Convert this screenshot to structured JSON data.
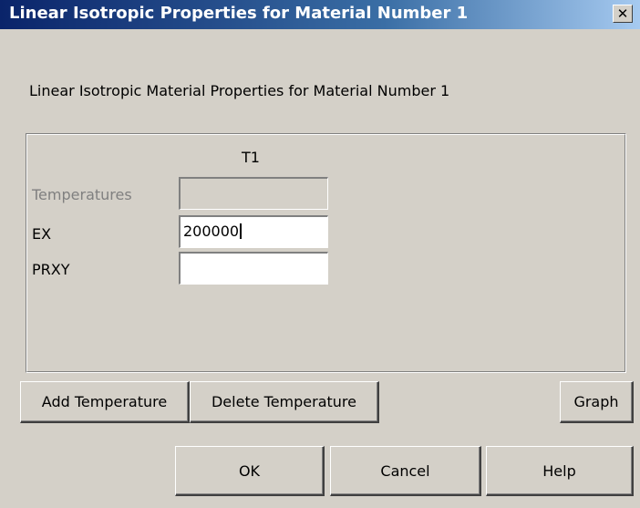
{
  "window": {
    "title": "Linear Isotropic Properties for Material Number 1",
    "close_icon": "close-icon"
  },
  "subtitle": "Linear Isotropic Material Properties for Material Number 1",
  "table": {
    "column_header": "T1",
    "rows": [
      {
        "label": "Temperatures",
        "value": "",
        "enabled": false
      },
      {
        "label": "EX",
        "value": "200000",
        "enabled": true
      },
      {
        "label": "PRXY",
        "value": "",
        "enabled": true
      }
    ]
  },
  "buttons": {
    "add_temperature": "Add Temperature",
    "delete_temperature": "Delete Temperature",
    "graph": "Graph",
    "ok": "OK",
    "cancel": "Cancel",
    "help": "Help"
  }
}
